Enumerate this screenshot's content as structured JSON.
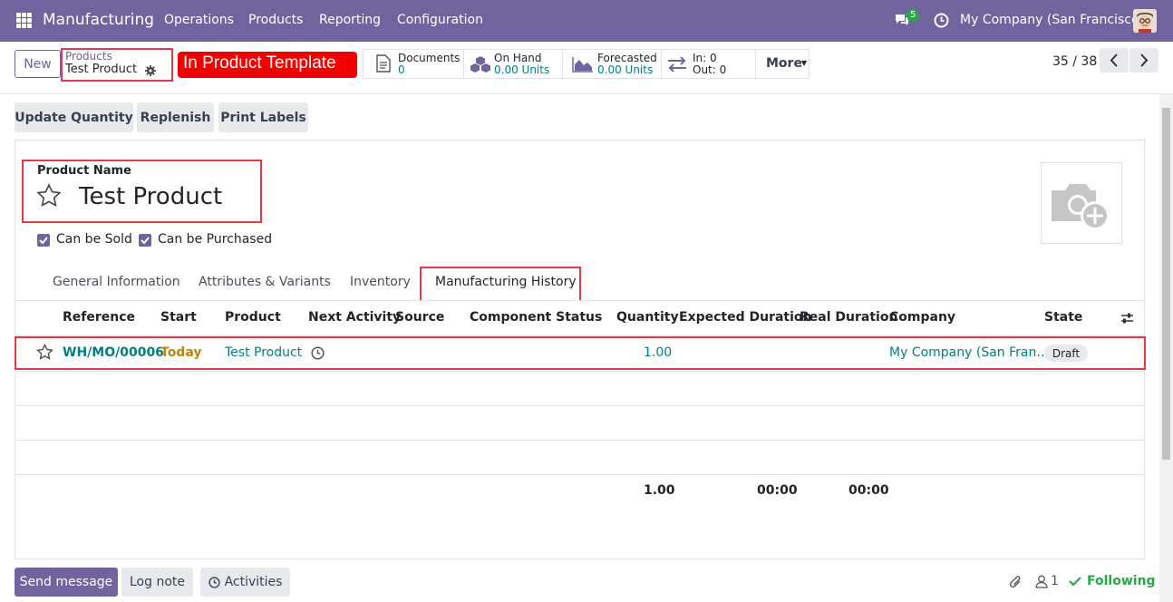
{
  "topbar": {
    "app_name": "Manufacturing",
    "menu": [
      "Operations",
      "Products",
      "Reporting",
      "Configuration"
    ],
    "message_count": "5",
    "company": "My Company (San Francisco)"
  },
  "control_panel": {
    "new_label": "New",
    "breadcrumb_parent": "Products",
    "breadcrumb_current": "Test Product",
    "annotation": "In Product Template",
    "stats": {
      "documents": {
        "label": "Documents",
        "value": "0"
      },
      "on_hand": {
        "label": "On Hand",
        "value": "0.00 Units"
      },
      "forecasted": {
        "label": "Forecasted",
        "value": "0.00 Units"
      },
      "in_out": {
        "in": "In: 0",
        "out": "Out: 0"
      },
      "more": "More"
    },
    "pager": "35 / 38"
  },
  "actions": [
    "Update Quantity",
    "Replenish",
    "Print Labels"
  ],
  "form": {
    "product_name_label": "Product Name",
    "product_name": "Test Product",
    "can_be_sold": "Can be Sold",
    "can_be_purchased": "Can be Purchased",
    "tabs": [
      "General Information",
      "Attributes & Variants",
      "Inventory",
      "Manufacturing History"
    ]
  },
  "table": {
    "headers": {
      "reference": "Reference",
      "start": "Start",
      "product": "Product",
      "next_activity": "Next Activity",
      "source": "Source",
      "component_status": "Component Status",
      "quantity": "Quantity",
      "expected_duration": "Expected Duration",
      "real_duration": "Real Duration",
      "company": "Company",
      "state": "State"
    },
    "row": {
      "reference": "WH/MO/00006",
      "start": "Today",
      "product": "Test Product",
      "quantity": "1.00",
      "company": "My Company (San Fran…",
      "state": "Draft"
    },
    "totals": {
      "quantity": "1.00",
      "expected_duration": "00:00",
      "real_duration": "00:00"
    }
  },
  "chatter": {
    "send_message": "Send message",
    "log_note": "Log note",
    "activities": "Activities",
    "followers": "1",
    "following": "Following"
  },
  "colors": {
    "brand": "#71639e",
    "link": "#017e84",
    "today": "#b8860b",
    "highlight": "#e63946",
    "following": "#28a745"
  }
}
